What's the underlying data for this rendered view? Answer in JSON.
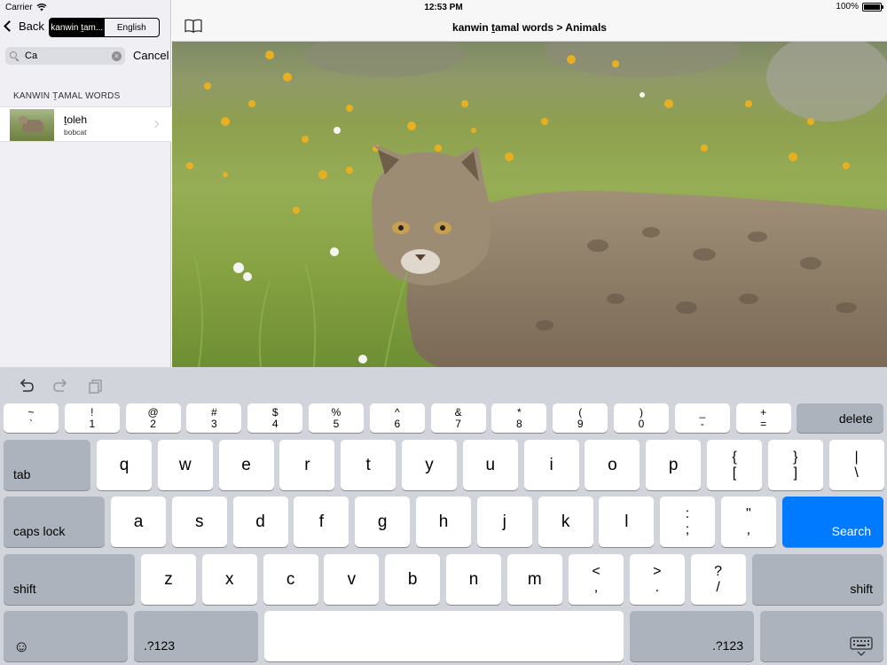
{
  "status_bar": {
    "carrier": "Carrier",
    "time": "12:53 PM",
    "battery": "100%"
  },
  "sidebar": {
    "back_label": "Back",
    "segments": [
      {
        "label": "kanwin ṯam...",
        "active": true
      },
      {
        "label": "English",
        "active": false
      }
    ],
    "search": {
      "value": "Ca",
      "cancel_label": "Cancel"
    },
    "section_header": "KANWIN ṮAMAL WORDS",
    "results": [
      {
        "title": "ṯoleh",
        "subtitle": "bobcat"
      }
    ]
  },
  "detail": {
    "title": "kanwin ṯamal words > Animals"
  },
  "keyboard": {
    "number_row": [
      {
        "top": "~",
        "bottom": "`"
      },
      {
        "top": "!",
        "bottom": "1"
      },
      {
        "top": "@",
        "bottom": "2"
      },
      {
        "top": "#",
        "bottom": "3"
      },
      {
        "top": "$",
        "bottom": "4"
      },
      {
        "top": "%",
        "bottom": "5"
      },
      {
        "top": "^",
        "bottom": "6"
      },
      {
        "top": "&",
        "bottom": "7"
      },
      {
        "top": "*",
        "bottom": "8"
      },
      {
        "top": "(",
        "bottom": "9"
      },
      {
        "top": ")",
        "bottom": "0"
      },
      {
        "top": "_",
        "bottom": "-"
      },
      {
        "top": "+",
        "bottom": "="
      }
    ],
    "delete_label": "delete",
    "tab_label": "tab",
    "row1_letters": [
      "q",
      "w",
      "e",
      "r",
      "t",
      "y",
      "u",
      "i",
      "o",
      "p"
    ],
    "row1_symbols": [
      {
        "top": "{",
        "bottom": "["
      },
      {
        "top": "}",
        "bottom": "]"
      },
      {
        "top": "|",
        "bottom": "\\"
      }
    ],
    "caps_label": "caps lock",
    "row2_letters": [
      "a",
      "s",
      "d",
      "f",
      "g",
      "h",
      "j",
      "k",
      "l"
    ],
    "row2_symbols": [
      {
        "top": ":",
        "bottom": ";"
      },
      {
        "top": "\"",
        "bottom": ","
      }
    ],
    "search_label": "Search",
    "shift_label": "shift",
    "row3_letters": [
      "z",
      "x",
      "c",
      "v",
      "b",
      "n",
      "m"
    ],
    "row3_symbols": [
      {
        "top": "<",
        "bottom": ","
      },
      {
        "top": ">",
        "bottom": "."
      },
      {
        "top": "?",
        "bottom": "/"
      }
    ],
    "numbers_label": ".?123",
    "emoji_icon": "emoji-icon",
    "dismiss_icon": "keyboard-dismiss-icon"
  },
  "colors": {
    "accent": "#007aff",
    "keyboard_bg": "#d1d5db",
    "modifier_key": "#adb3bc"
  }
}
